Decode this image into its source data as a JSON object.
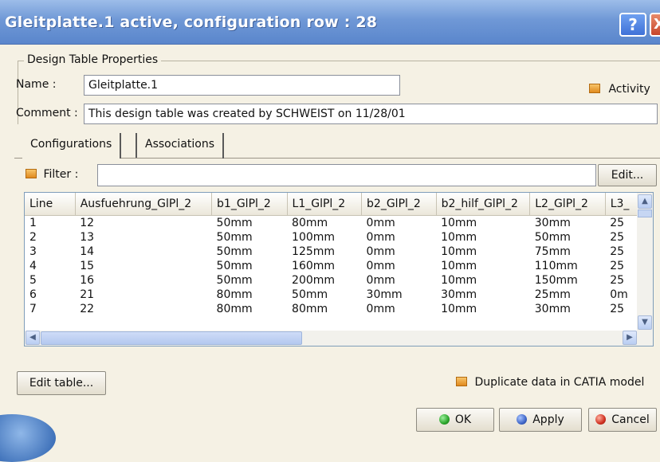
{
  "window": {
    "title": "Gleitplatte.1 active, configuration row : 28",
    "help_label": "?",
    "close_label": "X"
  },
  "properties": {
    "group_label": "Design Table Properties",
    "name_label": "Name :",
    "name_value": "Gleitplatte.1",
    "comment_label": "Comment :",
    "comment_value": "This design table was created by SCHWEIST on 11/28/01",
    "activity_label": "Activity"
  },
  "tabs": [
    {
      "label": "Configurations"
    },
    {
      "label": "Associations"
    }
  ],
  "filter": {
    "label": "Filter :",
    "value": "",
    "edit_label": "Edit..."
  },
  "table": {
    "columns": [
      "Line",
      "Ausfuehrung_GlPl_2",
      "b1_GlPl_2",
      "L1_GlPl_2",
      "b2_GlPl_2",
      "b2_hilf_GlPl_2",
      "L2_GlPl_2",
      "L3_"
    ],
    "rows": [
      [
        "1",
        "12",
        "50mm",
        "80mm",
        "0mm",
        "10mm",
        "30mm",
        "25"
      ],
      [
        "2",
        "13",
        "50mm",
        "100mm",
        "0mm",
        "10mm",
        "50mm",
        "25"
      ],
      [
        "3",
        "14",
        "50mm",
        "125mm",
        "0mm",
        "10mm",
        "75mm",
        "25"
      ],
      [
        "4",
        "15",
        "50mm",
        "160mm",
        "0mm",
        "10mm",
        "110mm",
        "25"
      ],
      [
        "5",
        "16",
        "50mm",
        "200mm",
        "0mm",
        "10mm",
        "150mm",
        "25"
      ],
      [
        "6",
        "21",
        "80mm",
        "50mm",
        "30mm",
        "30mm",
        "25mm",
        "0m"
      ],
      [
        "7",
        "22",
        "80mm",
        "80mm",
        "0mm",
        "10mm",
        "30mm",
        "25"
      ]
    ]
  },
  "footer": {
    "edit_table_label": "Edit table...",
    "duplicate_label": "Duplicate data in CATIA model",
    "ok_label": "OK",
    "apply_label": "Apply",
    "cancel_label": "Cancel"
  },
  "colors": {
    "accent": "#5a86cc",
    "background": "#f5f1e4",
    "ok": "#2aa52a",
    "apply": "#3f66c8",
    "cancel": "#d03020"
  }
}
